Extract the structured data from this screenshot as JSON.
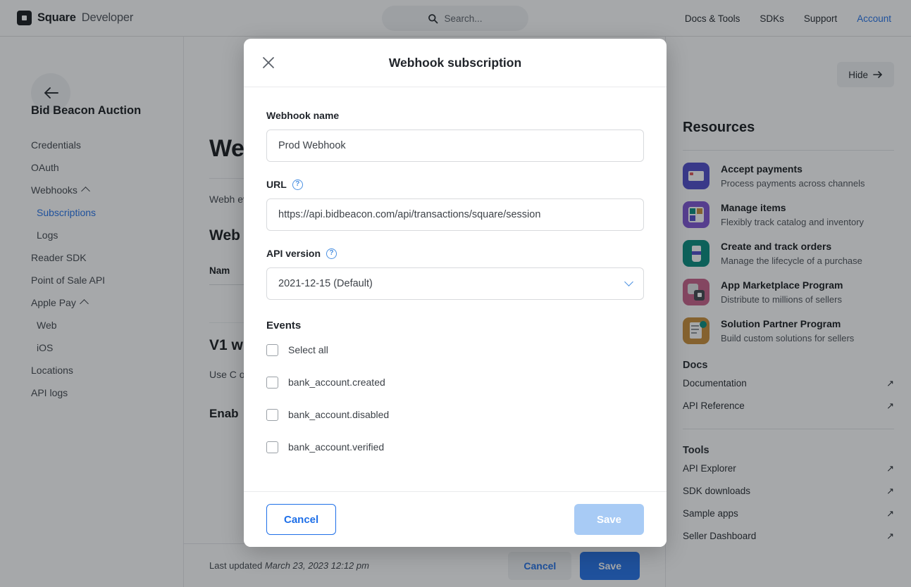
{
  "header": {
    "brand_name": "Square",
    "brand_sub": "Developer",
    "logo_icon": "square-logo-icon",
    "search": {
      "icon": "search-icon",
      "placeholder": "Search..."
    },
    "nav": [
      {
        "label": "Docs & Tools",
        "accent": false
      },
      {
        "label": "SDKs",
        "accent": false
      },
      {
        "label": "Support",
        "accent": false
      },
      {
        "label": "Account",
        "accent": true
      }
    ]
  },
  "sidebar": {
    "back_icon": "arrow-left-icon",
    "app_title": "Bid Beacon Auction",
    "items": [
      {
        "label": "Credentials",
        "level": 0,
        "active": false,
        "caret": false
      },
      {
        "label": "OAuth",
        "level": 0,
        "active": false,
        "caret": false
      },
      {
        "label": "Webhooks",
        "level": 0,
        "active": false,
        "caret": true
      },
      {
        "label": "Subscriptions",
        "level": 1,
        "active": true,
        "caret": false
      },
      {
        "label": "Logs",
        "level": 1,
        "active": false,
        "caret": false
      },
      {
        "label": "Reader SDK",
        "level": 0,
        "active": false,
        "caret": false
      },
      {
        "label": "Point of Sale API",
        "level": 0,
        "active": false,
        "caret": false
      },
      {
        "label": "Apple Pay",
        "level": 0,
        "active": false,
        "caret": true
      },
      {
        "label": "Web",
        "level": 1,
        "active": false,
        "caret": false
      },
      {
        "label": "iOS",
        "level": 1,
        "active": false,
        "caret": false
      },
      {
        "label": "Locations",
        "level": 0,
        "active": false,
        "caret": false
      },
      {
        "label": "API logs",
        "level": 0,
        "active": false,
        "caret": false
      }
    ]
  },
  "main": {
    "title": "We",
    "paragraph": "Webh\nevent",
    "section_title": "Web",
    "table_header": "Nam",
    "v1_title": "V1 w",
    "v1_paragraph": "Use C\noccur.\nthat V",
    "enable_title": "Enab",
    "footer": {
      "last_updated_label": "Last updated",
      "last_updated_value": "March 23, 2023 12:12 pm",
      "cancel_label": "Cancel",
      "save_label": "Save"
    }
  },
  "right_panel": {
    "hide_label": "Hide",
    "hide_icon": "arrow-right-icon",
    "title": "Resources",
    "resources": [
      {
        "title": "Accept payments",
        "desc": "Process payments across channels",
        "color": "#4a46c9",
        "icon": "credit-card-icon"
      },
      {
        "title": "Manage items",
        "desc": "Flexibly track catalog and inventory",
        "color": "#7b4fd0",
        "icon": "grid-items-icon"
      },
      {
        "title": "Create and track orders",
        "desc": "Manage the lifecycle of a purchase",
        "color": "#00897b",
        "icon": "coffee-cup-icon"
      },
      {
        "title": "App Marketplace Program",
        "desc": "Distribute to millions of sellers",
        "color": "#c75c86",
        "icon": "puzzle-piece-icon"
      },
      {
        "title": "Solution Partner Program",
        "desc": "Build custom solutions for sellers",
        "color": "#c98b33",
        "icon": "document-check-icon"
      }
    ],
    "docs_heading": "Docs",
    "docs_links": [
      {
        "label": "Documentation",
        "icon": "external-link-icon"
      },
      {
        "label": "API Reference",
        "icon": "external-link-icon"
      }
    ],
    "tools_heading": "Tools",
    "tools_links": [
      {
        "label": "API Explorer",
        "icon": "external-link-icon"
      },
      {
        "label": "SDK downloads",
        "icon": "external-link-icon"
      },
      {
        "label": "Sample apps",
        "icon": "external-link-icon"
      },
      {
        "label": "Seller Dashboard",
        "icon": "external-link-icon"
      }
    ]
  },
  "modal": {
    "title": "Webhook subscription",
    "close_icon": "close-icon",
    "name_label": "Webhook name",
    "name_value": "Prod Webhook",
    "url_label": "URL",
    "url_help_icon": "help-circle-icon",
    "url_value": "https://api.bidbeacon.com/api/transactions/square/session",
    "api_version_label": "API version",
    "api_version_help_icon": "help-circle-icon",
    "api_version_value": "2021-12-15 (Default)",
    "api_version_chevron": "chevron-down-icon",
    "events_label": "Events",
    "events": [
      {
        "label": "Select all",
        "checked": false
      },
      {
        "label": "bank_account.created",
        "checked": false
      },
      {
        "label": "bank_account.disabled",
        "checked": false
      },
      {
        "label": "bank_account.verified",
        "checked": false
      }
    ],
    "cancel_label": "Cancel",
    "save_label": "Save"
  },
  "colors": {
    "accent_blue": "#1e6fe8",
    "save_disabled": "#a8cbf5",
    "text_dark": "#21252b"
  }
}
